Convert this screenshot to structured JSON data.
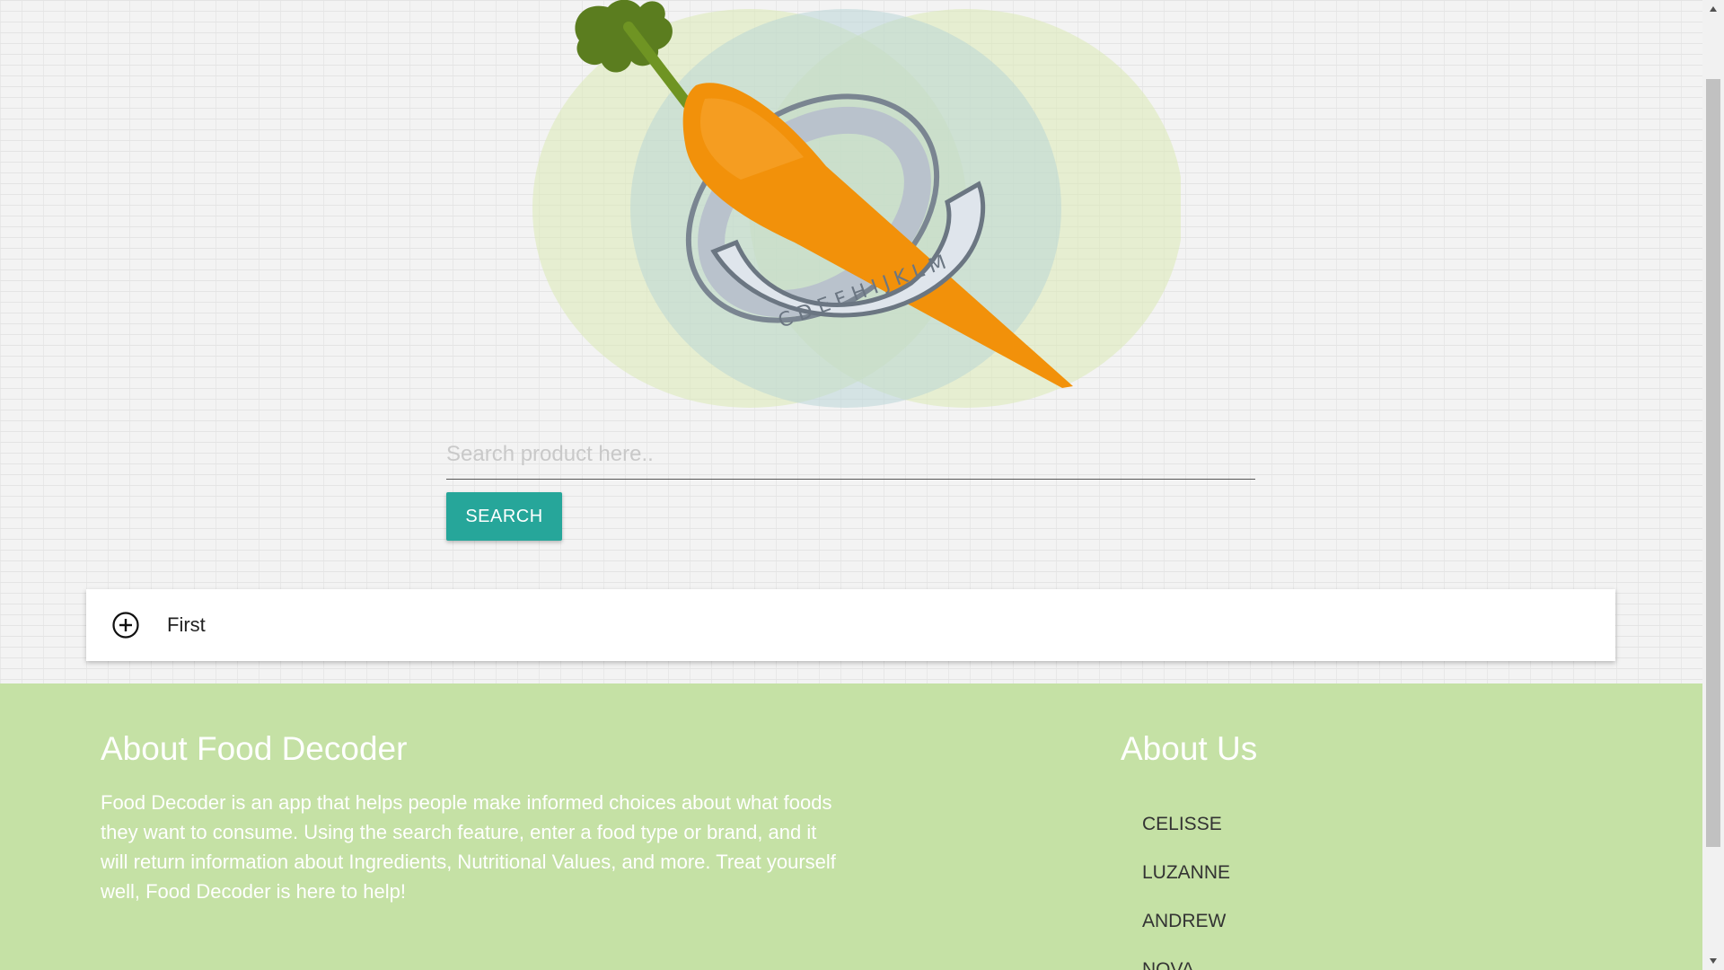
{
  "search": {
    "placeholder": "Search product here..",
    "button_label": "SEARCH"
  },
  "collapsible": {
    "items": [
      {
        "label": "First",
        "icon": "plus-circle-icon"
      }
    ]
  },
  "footer": {
    "about": {
      "title": "About Food Decoder",
      "text": "Food Decoder is an app that helps people make informed choices about what foods they want to consume. Using the search feature, enter a food type or brand, and it will return information about Ingredients, Nutritional Values, and more. Treat yourself well, Food Decoder is here to help!"
    },
    "about_us": {
      "title": "About Us",
      "members": [
        "CELISSE",
        "LUZANNE",
        "ANDREW",
        "NOVA"
      ]
    },
    "background_color": "#c5e1a5"
  },
  "logo": {
    "icon": "carrot-decoder-ring-logo",
    "ring_letters": "CDEFHIJKLM"
  },
  "colors": {
    "accent": "#26a69a",
    "carrot": "#f39c12"
  }
}
